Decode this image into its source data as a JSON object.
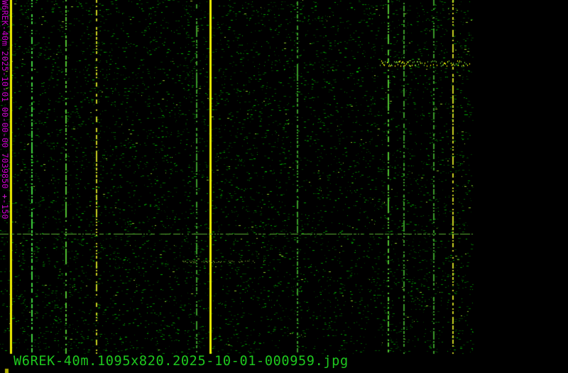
{
  "waterfall": {
    "side_label": "W6REK-40m 2025-10-01 00-00-00 7039850 +-150",
    "caption": "W6REK-40m.1095x820.2025-10-01-000959.jpg"
  },
  "colors": {
    "signal_bright": "#ffff00",
    "signal": "#3cc83c",
    "label": "#d000d0",
    "caption": "#1ec81e"
  }
}
